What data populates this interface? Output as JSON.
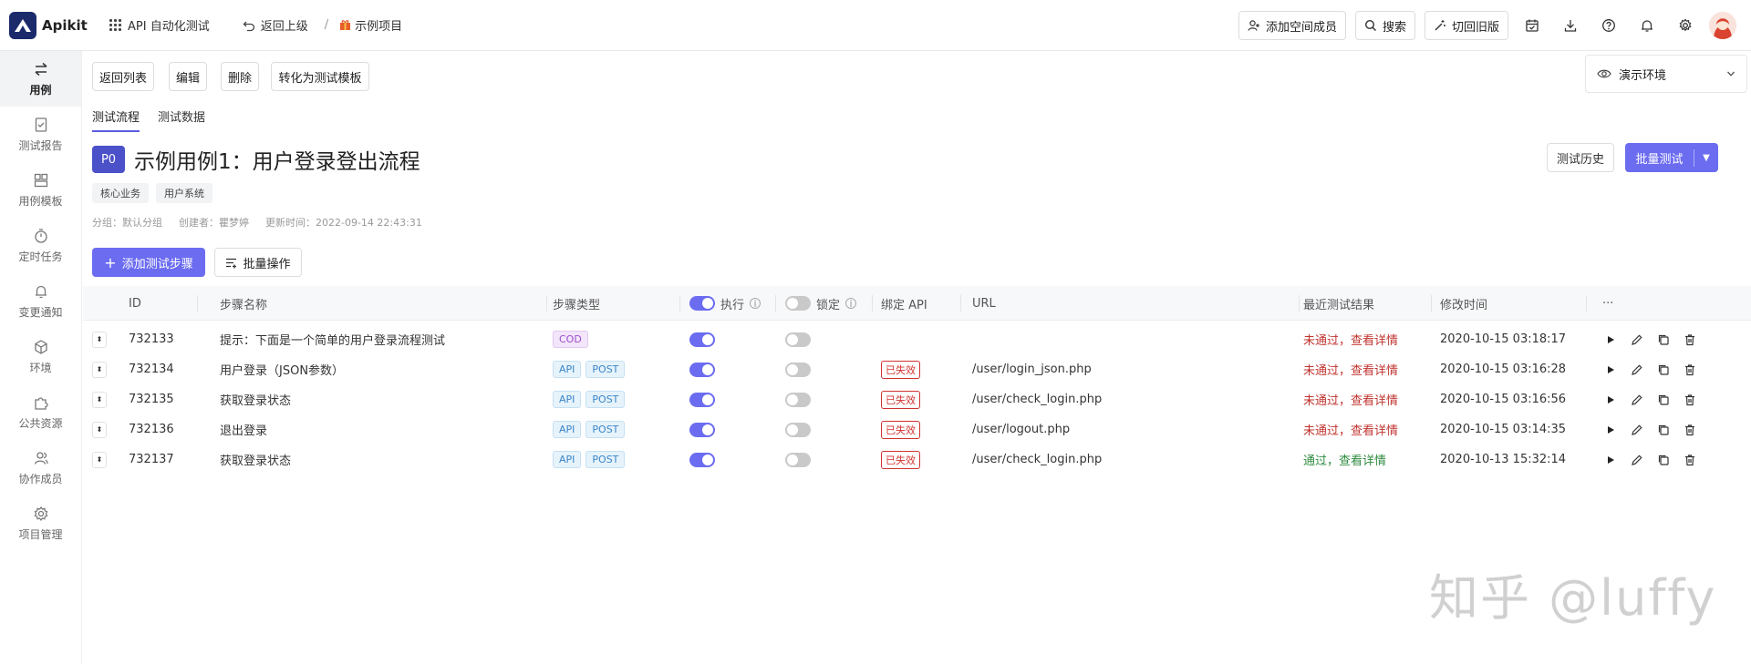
{
  "app": {
    "name": "Apikit"
  },
  "header": {
    "workspace": "API 自动化测试",
    "back": "返回上级",
    "separator": "/",
    "project": "示例项目",
    "add_member": "添加空间成员",
    "search": "搜索",
    "old_version": "切回旧版"
  },
  "sidebar": {
    "items": [
      {
        "label": "用例",
        "icon": "swap-arrows-icon",
        "active": true
      },
      {
        "label": "测试报告",
        "icon": "report-icon"
      },
      {
        "label": "用例模板",
        "icon": "template-icon"
      },
      {
        "label": "定时任务",
        "icon": "timer-icon"
      },
      {
        "label": "变更通知",
        "icon": "bell-icon"
      },
      {
        "label": "环境",
        "icon": "cube-icon"
      },
      {
        "label": "公共资源",
        "icon": "puzzle-icon"
      },
      {
        "label": "协作成员",
        "icon": "members-icon"
      },
      {
        "label": "项目管理",
        "icon": "gear-icon"
      }
    ]
  },
  "toolbar": {
    "back_list": "返回列表",
    "edit": "编辑",
    "delete": "删除",
    "to_template": "转化为测试模板"
  },
  "env": {
    "label": "演示环境"
  },
  "tabs": [
    {
      "label": "测试流程",
      "active": true
    },
    {
      "label": "测试数据"
    }
  ],
  "case": {
    "priority": "P0",
    "title": "示例用例1：用户登录登出流程",
    "tags": [
      "核心业务",
      "用户系统"
    ],
    "group": "分组：默认分组",
    "creator": "创建者：瞿梦婷",
    "updated": "更新时间：2022-09-14 22:43:31",
    "history_btn": "测试历史",
    "batch_test_btn": "批量测试"
  },
  "actions": {
    "add_step": "添加测试步骤",
    "bulk_ops": "批量操作"
  },
  "table": {
    "headers": {
      "id": "ID",
      "name": "步骤名称",
      "type": "步骤类型",
      "exec": "执行",
      "lock": "锁定",
      "api": "绑定 API",
      "url": "URL",
      "result": "最近测试结果",
      "mtime": "修改时间",
      "more": "···"
    },
    "rows": [
      {
        "id": "732133",
        "name": "提示：下面是一个简单的用户登录流程测试",
        "types": [
          "COD"
        ],
        "exec": true,
        "lock": false,
        "api": "",
        "url": "",
        "result": "未通过，查看详情",
        "pass": false,
        "mtime": "2020-10-15 03:18:17"
      },
      {
        "id": "732134",
        "name": "用户登录（JSON参数）",
        "types": [
          "API",
          "POST"
        ],
        "exec": true,
        "lock": false,
        "api": "已失效",
        "url": "/user/login_json.php",
        "result": "未通过，查看详情",
        "pass": false,
        "mtime": "2020-10-15 03:16:28"
      },
      {
        "id": "732135",
        "name": "获取登录状态",
        "types": [
          "API",
          "POST"
        ],
        "exec": true,
        "lock": false,
        "api": "已失效",
        "url": "/user/check_login.php",
        "result": "未通过，查看详情",
        "pass": false,
        "mtime": "2020-10-15 03:16:56"
      },
      {
        "id": "732136",
        "name": "退出登录",
        "types": [
          "API",
          "POST"
        ],
        "exec": true,
        "lock": false,
        "api": "已失效",
        "url": "/user/logout.php",
        "result": "未通过，查看详情",
        "pass": false,
        "mtime": "2020-10-15 03:14:35"
      },
      {
        "id": "732137",
        "name": "获取登录状态",
        "types": [
          "API",
          "POST"
        ],
        "exec": true,
        "lock": false,
        "api": "已失效",
        "url": "/user/check_login.php",
        "result": "通过，查看详情",
        "pass": true,
        "mtime": "2020-10-13 15:32:14"
      }
    ]
  },
  "watermark": "知乎 @luffy",
  "colors": {
    "accent": "#6b6cf0",
    "fail": "#c0342f",
    "pass": "#2e8b3e",
    "brand": "#1b2a6b"
  }
}
